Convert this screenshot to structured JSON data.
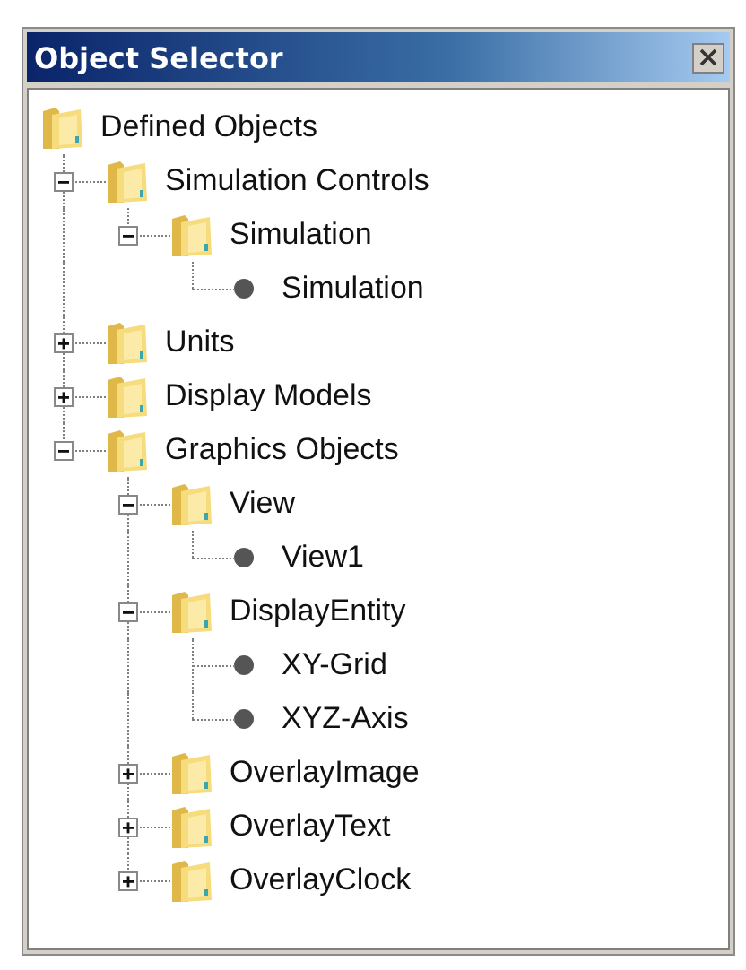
{
  "window": {
    "title": "Object Selector"
  },
  "tree": [
    {
      "label": "Defined Objects",
      "kind": "folder",
      "children": [
        {
          "label": "Simulation Controls",
          "kind": "folder",
          "expanded": true,
          "children": [
            {
              "label": "Simulation",
              "kind": "folder",
              "expanded": true,
              "children": [
                {
                  "label": "Simulation",
                  "kind": "leaf"
                }
              ]
            }
          ]
        },
        {
          "label": "Units",
          "kind": "folder",
          "expanded": false
        },
        {
          "label": "Display Models",
          "kind": "folder",
          "expanded": false
        },
        {
          "label": "Graphics Objects",
          "kind": "folder",
          "expanded": true,
          "children": [
            {
              "label": "View",
              "kind": "folder",
              "expanded": true,
              "children": [
                {
                  "label": "View1",
                  "kind": "leaf"
                }
              ]
            },
            {
              "label": "DisplayEntity",
              "kind": "folder",
              "expanded": true,
              "children": [
                {
                  "label": "XY-Grid",
                  "kind": "leaf"
                },
                {
                  "label": "XYZ-Axis",
                  "kind": "leaf"
                }
              ]
            },
            {
              "label": "OverlayImage",
              "kind": "folder",
              "expanded": false
            },
            {
              "label": "OverlayText",
              "kind": "folder",
              "expanded": false
            },
            {
              "label": "OverlayClock",
              "kind": "folder",
              "expanded": false
            }
          ]
        }
      ]
    }
  ]
}
